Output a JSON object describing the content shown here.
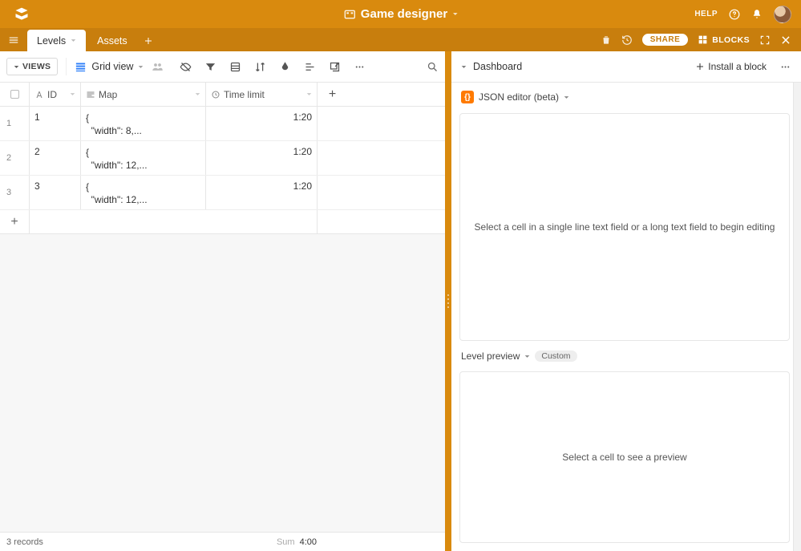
{
  "topbar": {
    "title": "Game designer",
    "help_label": "HELP"
  },
  "tabs": [
    {
      "label": "Levels",
      "active": true
    },
    {
      "label": "Assets",
      "active": false
    }
  ],
  "tabsbar": {
    "share_label": "SHARE",
    "blocks_label": "BLOCKS"
  },
  "left": {
    "views_button": "VIEWS",
    "view_name": "Grid view",
    "columns": {
      "id": "ID",
      "map": "Map",
      "time": "Time limit"
    },
    "rows": [
      {
        "num": "1",
        "id": "1",
        "map_line1": "{",
        "map_line2": "  \"width\": 8,...",
        "time": "1:20"
      },
      {
        "num": "2",
        "id": "2",
        "map_line1": "{",
        "map_line2": "  \"width\": 12,...",
        "time": "1:20"
      },
      {
        "num": "3",
        "id": "3",
        "map_line1": "{",
        "map_line2": "  \"width\": 12,...",
        "time": "1:20"
      }
    ],
    "footer": {
      "records": "3 records",
      "sum_label": "Sum",
      "sum_value": "4:00"
    }
  },
  "right": {
    "dashboard_label": "Dashboard",
    "install_label": "Install a block",
    "json_block": {
      "title": "JSON editor (beta)",
      "placeholder": "Select a cell in a single line text field or a long text field to begin editing"
    },
    "preview_block": {
      "title": "Level preview",
      "badge": "Custom",
      "placeholder": "Select a cell to see a preview"
    }
  }
}
